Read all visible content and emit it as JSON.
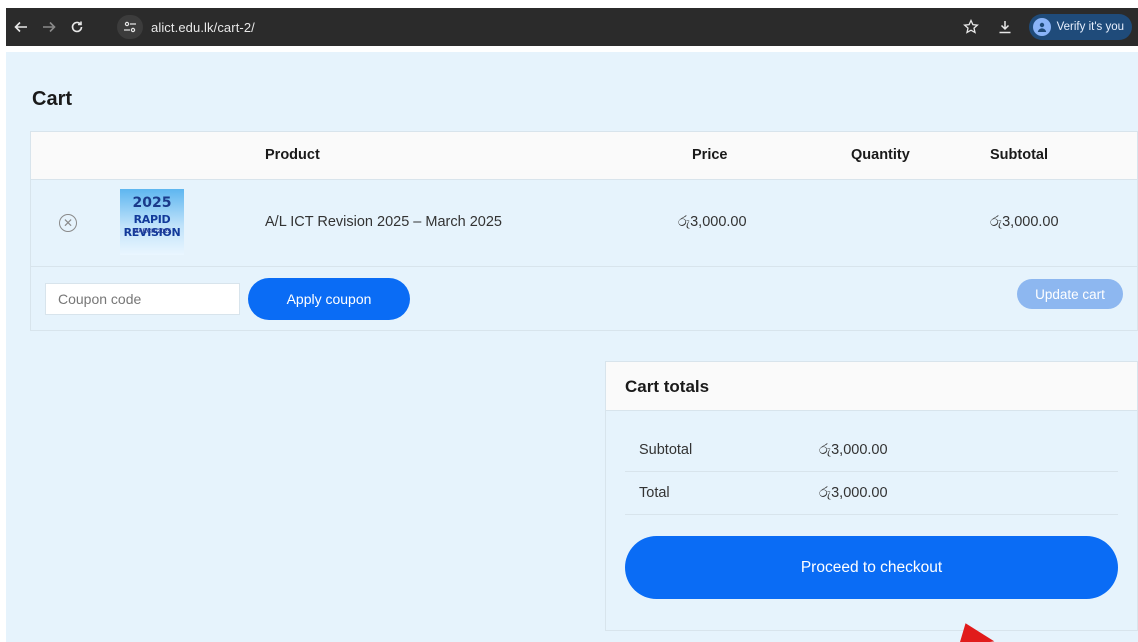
{
  "browser": {
    "url": "alict.edu.lk/cart-2/",
    "verify_label": "Verify it's you",
    "icons": [
      "back-icon",
      "forward-icon",
      "reload-icon",
      "site-info-icon",
      "bookmark-star-icon",
      "download-icon",
      "profile-icon"
    ]
  },
  "page": {
    "title": "Cart"
  },
  "cart_table": {
    "headers": {
      "product": "Product",
      "price": "Price",
      "quantity": "Quantity",
      "subtotal": "Subtotal"
    },
    "rows": [
      {
        "thumb_year": "2025",
        "thumb_title": "RAPID REVISION",
        "thumb_date": "MARCH-2025",
        "product": "A/L ICT Revision 2025 – March 2025",
        "price": "රු3,000.00",
        "quantity": "",
        "subtotal": "රු3,000.00"
      }
    ]
  },
  "coupon": {
    "placeholder": "Coupon code",
    "value": "",
    "apply_label": "Apply coupon",
    "update_label": "Update cart"
  },
  "cart_totals": {
    "title": "Cart totals",
    "subtotal_label": "Subtotal",
    "subtotal_value": "රු3,000.00",
    "total_label": "Total",
    "total_value": "රු3,000.00",
    "checkout_label": "Proceed to checkout"
  },
  "colors": {
    "primary": "#0a6cf5",
    "update_disabled": "#8db7f0",
    "page_bg": "#e6f3fc",
    "chrome_bg": "#2b2b2b"
  }
}
